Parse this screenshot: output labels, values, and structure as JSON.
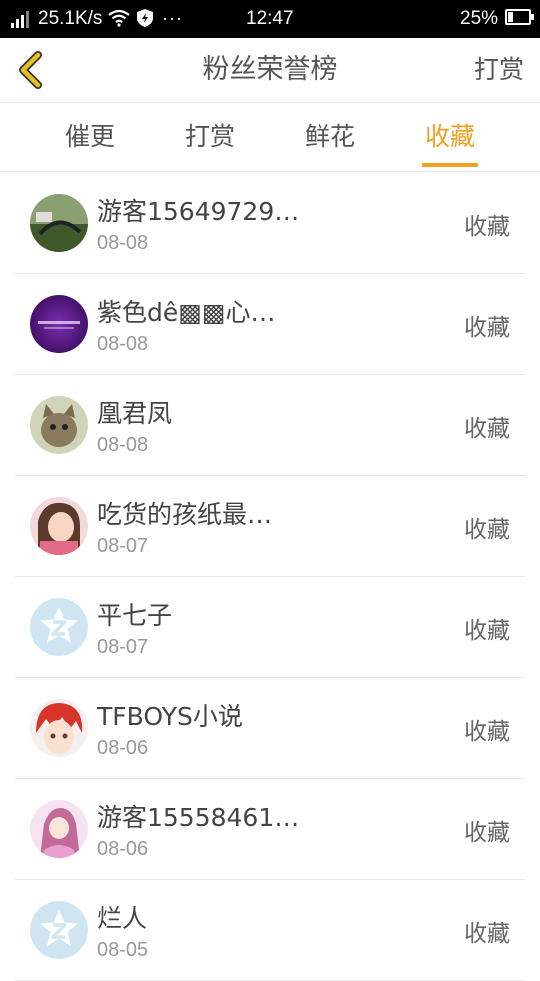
{
  "status_bar": {
    "speed": "25.1K/s",
    "time": "12:47",
    "battery_percent": "25%",
    "battery_level": 0.25,
    "more": "···"
  },
  "header": {
    "title": "粉丝荣誉榜",
    "reward_label": "打赏"
  },
  "tabs": [
    {
      "label": "催更",
      "active": false
    },
    {
      "label": "打赏",
      "active": false
    },
    {
      "label": "鲜花",
      "active": false
    },
    {
      "label": "收藏",
      "active": true
    }
  ],
  "fans": [
    {
      "name": "游客15649729…",
      "date": "08-08",
      "action": "收藏",
      "avatar": "landscape-photo"
    },
    {
      "name": "紫色dê▩▩心…",
      "date": "08-08",
      "action": "收藏",
      "avatar": "purple-text-image"
    },
    {
      "name": "凰君凤",
      "date": "08-08",
      "action": "收藏",
      "avatar": "cat-photo"
    },
    {
      "name": "吃货的孩纸最…",
      "date": "08-07",
      "action": "收藏",
      "avatar": "girl-photo"
    },
    {
      "name": "平七子",
      "date": "08-07",
      "action": "收藏",
      "avatar": "default-avatar"
    },
    {
      "name": "TFBOYS小说",
      "date": "08-06",
      "action": "收藏",
      "avatar": "anime-boy"
    },
    {
      "name": "游客15558461…",
      "date": "08-06",
      "action": "收藏",
      "avatar": "anime-girl"
    },
    {
      "name": "烂人",
      "date": "08-05",
      "action": "收藏",
      "avatar": "default-avatar"
    }
  ],
  "colors": {
    "accent": "#f0a020",
    "back_arrow": "#e8c020",
    "default_avatar_bg": "#cfe6f2"
  }
}
